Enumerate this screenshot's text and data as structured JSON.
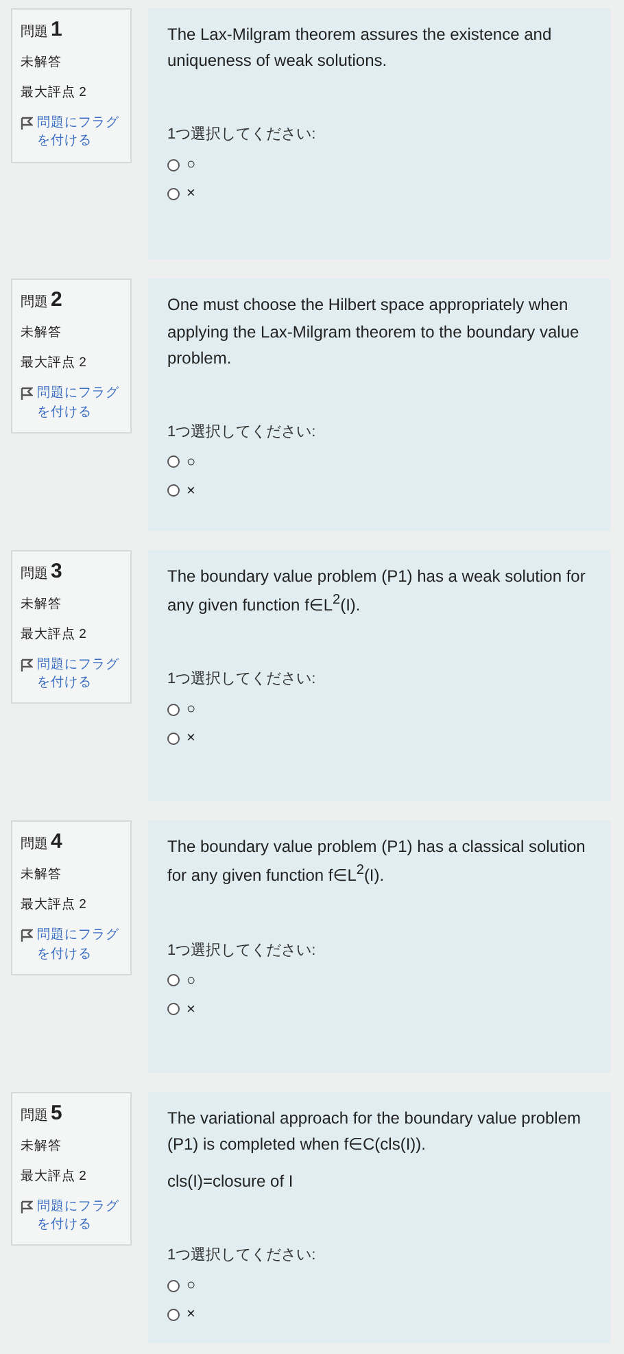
{
  "questions": [
    {
      "label": "問題",
      "number": "1",
      "status": "未解答",
      "max_mark": "最大評点 2",
      "flag_link": "問題にフラグを付ける",
      "texts": [
        "The Lax-Milgram theorem assures the existence and uniqueness of weak solutions."
      ],
      "prompt": "1つ選択してください:",
      "options": [
        {
          "label": "○",
          "selected": false
        },
        {
          "label": "×",
          "selected": false
        }
      ]
    },
    {
      "label": "問題",
      "number": "2",
      "status": "未解答",
      "max_mark": "最大評点 2",
      "flag_link": "問題にフラグを付ける",
      "texts": [
        "One must choose the Hilbert space appropriately when applying the Lax-Milgram theorem to the boundary value problem."
      ],
      "prompt": "1つ選択してください:",
      "options": [
        {
          "label": "○",
          "selected": false
        },
        {
          "label": "×",
          "selected": false
        }
      ]
    },
    {
      "label": "問題",
      "number": "3",
      "status": "未解答",
      "max_mark": "最大評点 2",
      "flag_link": "問題にフラグを付ける",
      "texts": [
        "The boundary value problem (P1) has a weak solution for any given function f∈L$^{2}$(I)."
      ],
      "prompt": "1つ選択してください:",
      "options": [
        {
          "label": "○",
          "selected": false
        },
        {
          "label": "×",
          "selected": false
        }
      ]
    },
    {
      "label": "問題",
      "number": "4",
      "status": "未解答",
      "max_mark": "最大評点 2",
      "flag_link": "問題にフラグを付ける",
      "texts": [
        "The boundary value problem (P1) has a classical solution for any given function f∈L$^{2}$(I)."
      ],
      "prompt": "1つ選択してください:",
      "options": [
        {
          "label": "○",
          "selected": false
        },
        {
          "label": "×",
          "selected": false
        }
      ]
    },
    {
      "label": "問題",
      "number": "5",
      "status": "未解答",
      "max_mark": "最大評点 2",
      "flag_link": "問題にフラグを付ける",
      "texts": [
        "The variational approach for the boundary value problem (P1) is completed when f∈C(cls(I)).",
        "cls(I)=closure of I"
      ],
      "prompt": "1つ選択してください:",
      "options": [
        {
          "label": "○",
          "selected": false
        },
        {
          "label": "×",
          "selected": false
        }
      ]
    }
  ]
}
